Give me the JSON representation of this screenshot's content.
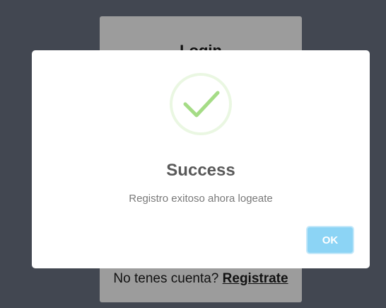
{
  "login": {
    "title": "Login",
    "register_prompt": "No tenes cuenta?",
    "register_link": "Registrate"
  },
  "modal": {
    "icon": "checkmark-icon",
    "title": "Success",
    "message": "Registro exitoso ahora logeate",
    "ok_label": "OK"
  },
  "colors": {
    "overlay_background": "#424751",
    "card_background": "#9c9c9c",
    "success_green": "#a5dc86",
    "ok_button": "#8cd4f5"
  }
}
